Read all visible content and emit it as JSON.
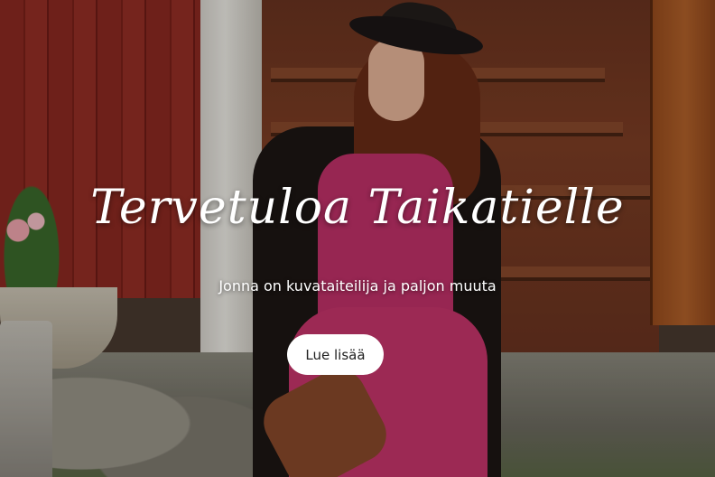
{
  "hero": {
    "title": "Tervetuloa Taikatielle",
    "subtitle": "Jonna on kuvataiteilija ja paljon muuta",
    "cta_label": "Lue lisää",
    "background_image": "woman-in-black-hat-sitting-on-wooden-steps"
  },
  "colors": {
    "text": "#ffffff",
    "button_bg": "#ffffff",
    "button_text": "#222222"
  }
}
